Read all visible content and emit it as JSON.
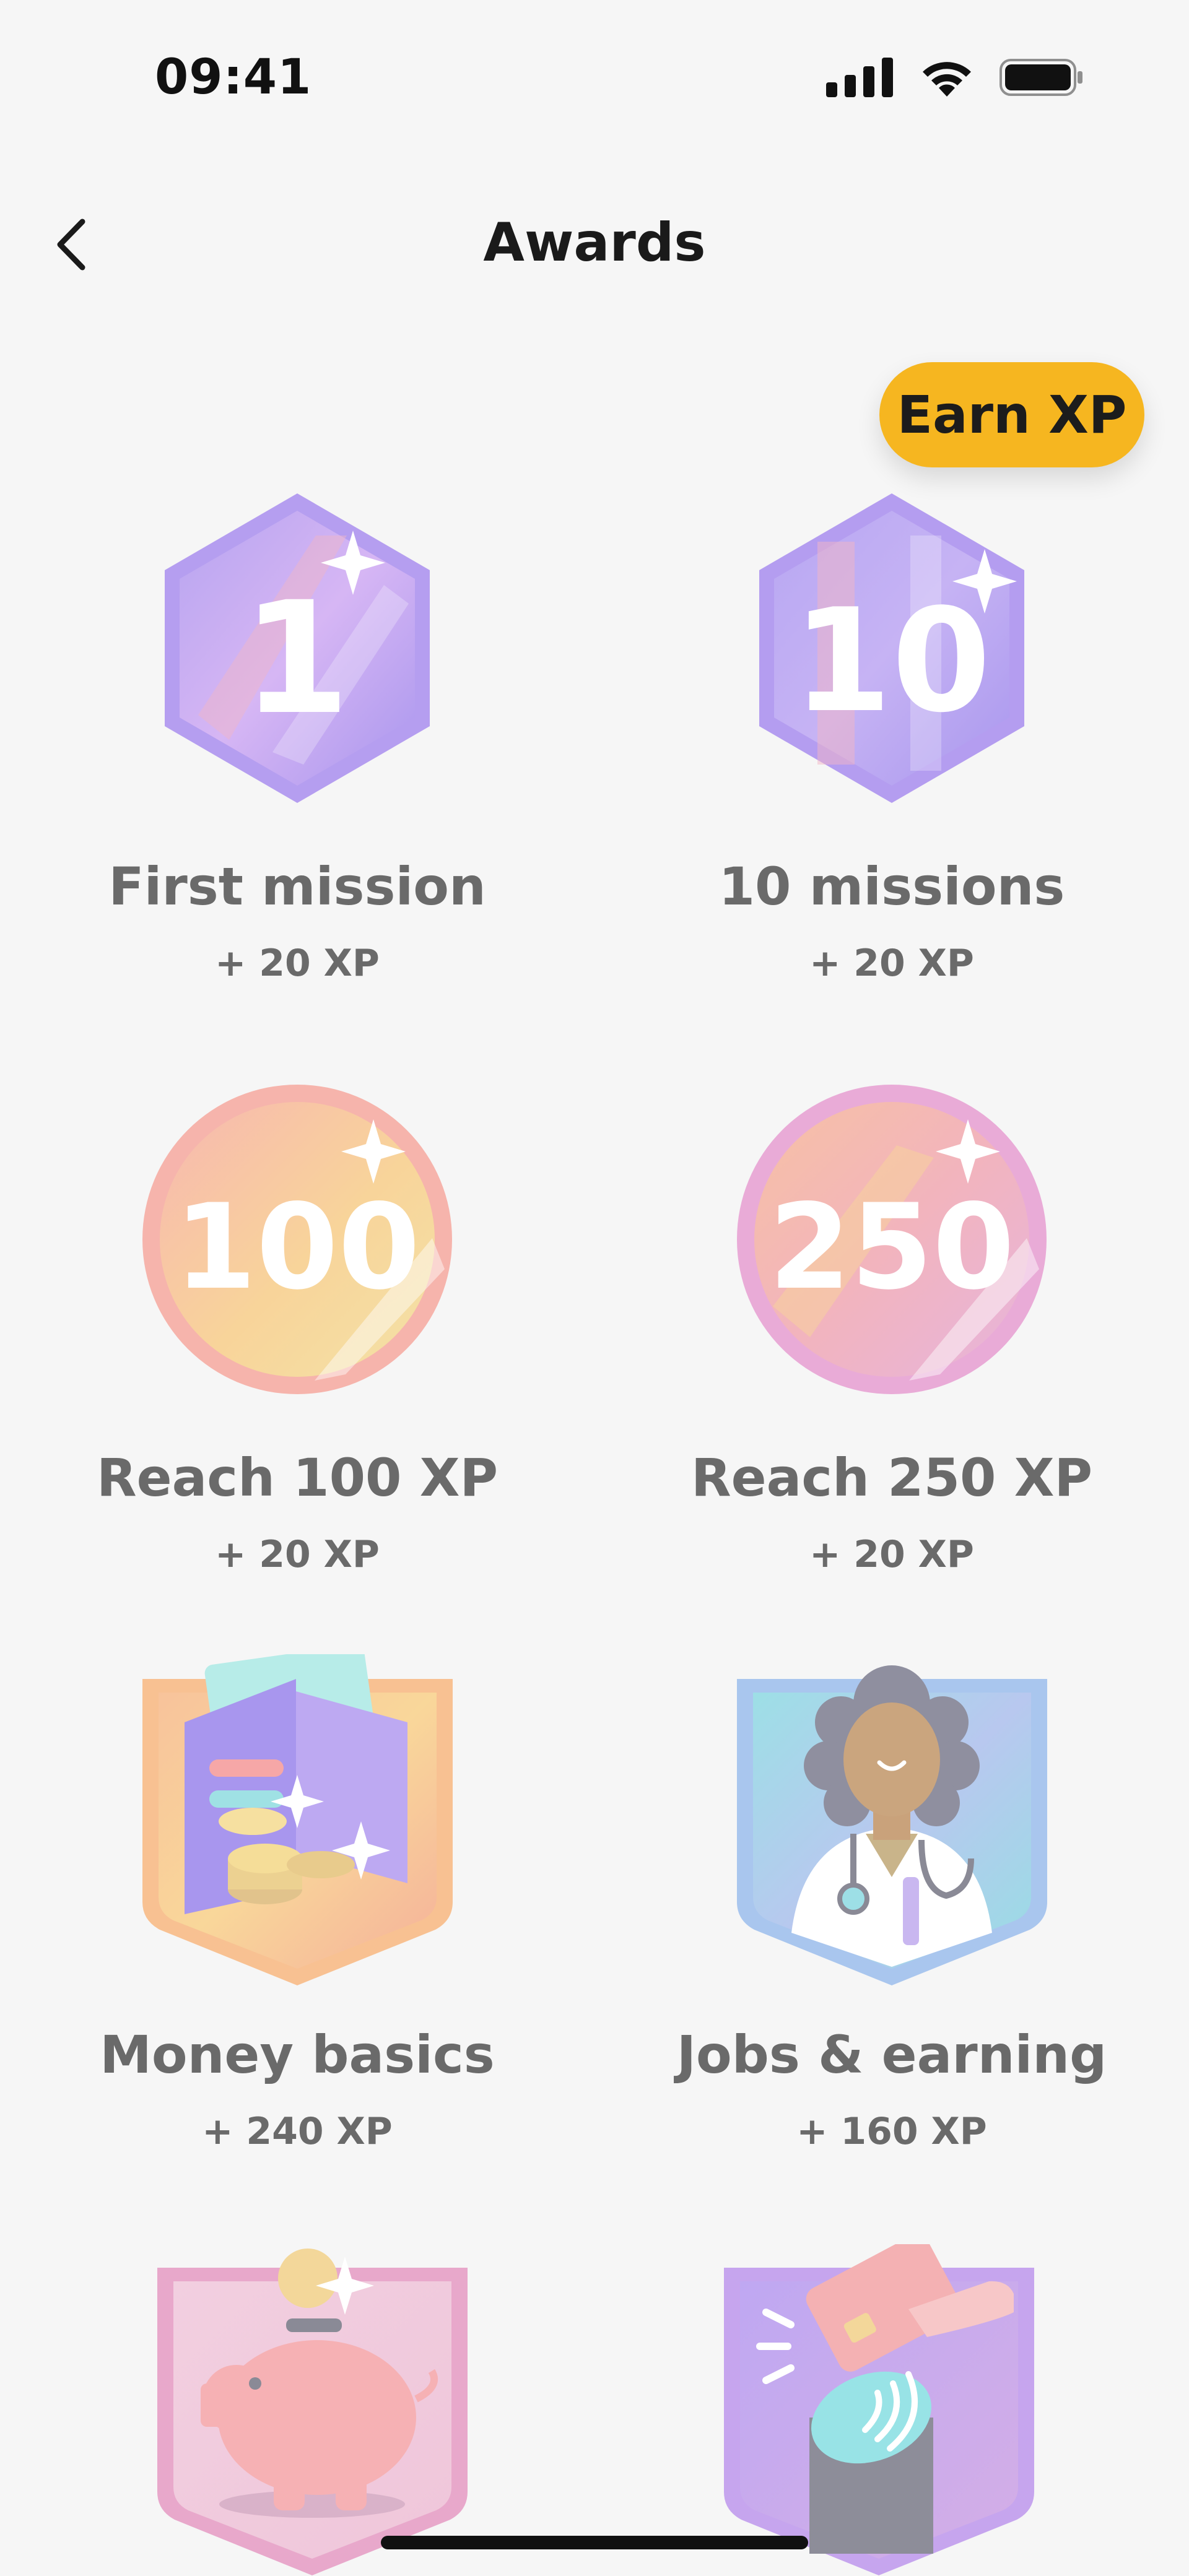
{
  "status_bar": {
    "time": "09:41"
  },
  "nav": {
    "title": "Awards"
  },
  "earn_xp": {
    "label": "Earn XP"
  },
  "awards": [
    {
      "name": "First mission",
      "xp": "+ 20 XP",
      "badge_text": "1"
    },
    {
      "name": "10 missions",
      "xp": "+ 20 XP",
      "badge_text": "10"
    },
    {
      "name": "Reach 100 XP",
      "xp": "+ 20 XP",
      "badge_text": "100"
    },
    {
      "name": "Reach 250 XP",
      "xp": "+ 20 XP",
      "badge_text": "250"
    },
    {
      "name": "Money basics",
      "xp": "+ 240 XP"
    },
    {
      "name": "Jobs & earning",
      "xp": "+ 160 XP"
    }
  ],
  "colors": {
    "accent": "#f6b620",
    "background": "#f6f6f6",
    "text_muted": "#6a6a6a"
  }
}
